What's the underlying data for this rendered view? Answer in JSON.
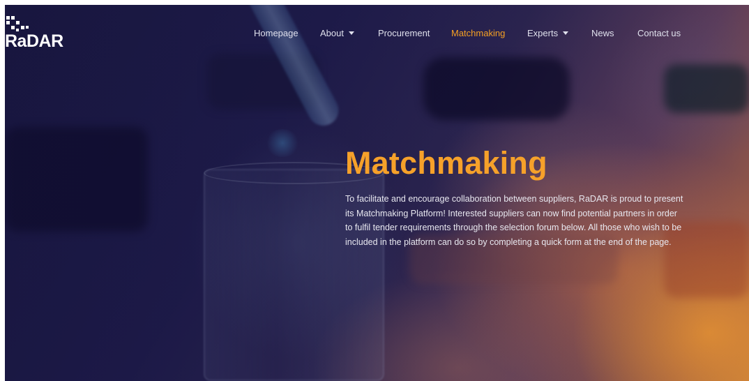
{
  "brand": {
    "logo_text": "RaDAR"
  },
  "nav": {
    "items": [
      {
        "label": "Homepage",
        "has_dropdown": false,
        "active": false
      },
      {
        "label": "About",
        "has_dropdown": true,
        "active": false
      },
      {
        "label": "Procurement",
        "has_dropdown": false,
        "active": false
      },
      {
        "label": "Matchmaking",
        "has_dropdown": false,
        "active": true
      },
      {
        "label": "Experts",
        "has_dropdown": true,
        "active": false
      },
      {
        "label": "News",
        "has_dropdown": false,
        "active": false
      },
      {
        "label": "Contact us",
        "has_dropdown": false,
        "active": false
      }
    ]
  },
  "hero": {
    "title": "Matchmaking",
    "description": "To facilitate and encourage collaboration between suppliers, RaDAR is proud to present its Matchmaking Platform! Interested suppliers can now find potential partners in order to fulfil tender requirements through the selection forum below. All those who wish to be included in the platform can do so by completing a quick form at the end of the page."
  },
  "colors": {
    "accent": "#f6a12a",
    "nav_text": "#dfe0ec",
    "background_dark": "#1c1a44"
  }
}
